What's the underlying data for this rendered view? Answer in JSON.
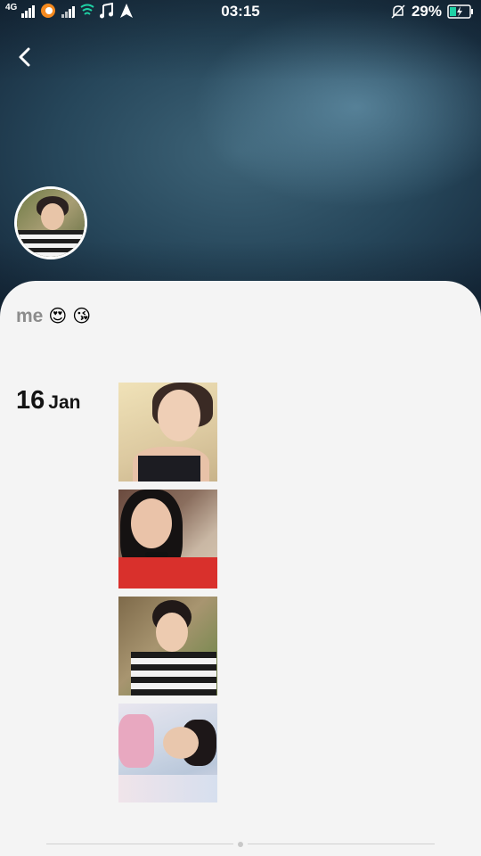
{
  "status_bar": {
    "network": "4G",
    "time": "03:15",
    "battery_percent": "29%"
  },
  "profile": {
    "title": "me",
    "title_emojis": [
      "😍",
      "😘"
    ]
  },
  "timeline": {
    "date_day": "16",
    "date_month": "Jan",
    "photos": [
      {
        "name": "photo-selfie-black-top"
      },
      {
        "name": "photo-selfie-red-top"
      },
      {
        "name": "photo-selfie-striped-shirt"
      },
      {
        "name": "photo-selfie-lying-down"
      }
    ]
  },
  "colors": {
    "accent_status_battery": "#1fd1a5",
    "cover_dark": "#1c3546",
    "card_bg": "#f4f4f4"
  }
}
